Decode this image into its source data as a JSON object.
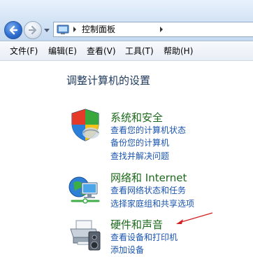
{
  "nav": {
    "address_label": "控制面板"
  },
  "menu": [
    {
      "label": "文件(F)"
    },
    {
      "label": "编辑(E)"
    },
    {
      "label": "查看(V)"
    },
    {
      "label": "工具(T)"
    },
    {
      "label": "帮助(H)"
    }
  ],
  "main": {
    "title": "调整计算机的设置",
    "categories": [
      {
        "heading": "系统和安全",
        "icon": "shield-icon",
        "links": [
          "查看您的计算机状态",
          "备份您的计算机",
          "查找并解决问题"
        ]
      },
      {
        "heading": "网络和 Internet",
        "icon": "network-globe-icon",
        "links": [
          "查看网络状态和任务",
          "选择家庭组和共享选项"
        ]
      },
      {
        "heading": "硬件和声音",
        "icon": "printer-speaker-icon",
        "links": [
          "查看设备和打印机",
          "添加设备"
        ]
      }
    ]
  },
  "colors": {
    "heading_green": "#1c6a1c",
    "link_blue": "#1a55b0",
    "annotation_red": "#d42020"
  }
}
